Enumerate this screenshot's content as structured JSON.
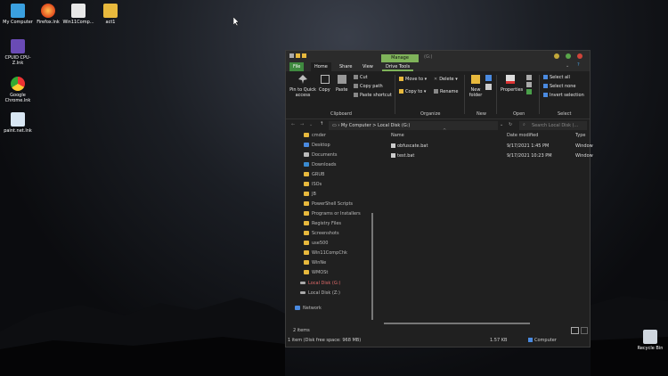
{
  "desktop": {
    "icons": [
      {
        "label": "My Computer"
      },
      {
        "label": "Firefox.lnk"
      },
      {
        "label": "Win11Comp..."
      },
      {
        "label": "act1"
      },
      {
        "label": "CPUID CPU-Z.lnk"
      },
      {
        "label": "Google Chrome.lnk"
      },
      {
        "label": "paint.net.lnk"
      },
      {
        "label": "Recycle Bin"
      }
    ]
  },
  "window": {
    "context_tab": "Manage",
    "context_title": "(G:)",
    "tabs": [
      "File",
      "Home",
      "Share",
      "View",
      "Drive Tools"
    ],
    "ribbon": {
      "pin": "Pin to Quick access",
      "copy": "Copy",
      "paste": "Paste",
      "cut": "Cut",
      "copy_path": "Copy path",
      "paste_shortcut": "Paste shortcut",
      "clipboard": "Clipboard",
      "move_to": "Move to",
      "copy_to": "Copy to",
      "delete": "Delete",
      "rename": "Rename",
      "organize": "Organize",
      "new_folder": "New folder",
      "new": "New",
      "properties": "Properties",
      "open": "Open",
      "select_all": "Select all",
      "select_none": "Select none",
      "invert_selection": "Invert selection",
      "select": "Select"
    },
    "address": {
      "part1": "My Computer",
      "sep": ">",
      "part2": "Local Disk (G:)"
    },
    "search_placeholder": "Search Local Disk (...",
    "nav_items": [
      "cmder",
      "Desktop",
      "Documents",
      "Downloads",
      "GRUB",
      "ISOs",
      "JB",
      "PowerShell Scripts",
      "Programs or Installers",
      "Registry Files",
      "Screenshots",
      "use500",
      "Win11CompChk",
      "WinNe",
      "WMOSt",
      "Local Disk (G:)",
      "Local Disk (Z:)",
      "Network"
    ],
    "columns": {
      "name": "Name",
      "date": "Date modified",
      "type": "Type"
    },
    "files": [
      {
        "name": "obfuscate.bat",
        "date": "9/17/2021 1:45 PM",
        "type": "Window"
      },
      {
        "name": "test.bat",
        "date": "9/17/2021 10:23 PM",
        "type": "Window"
      }
    ],
    "status_items": "2 items",
    "status_bottom_left": "1 item (Disk free space: 968 MB)",
    "status_size": "1.57 KB",
    "status_location": "Computer"
  },
  "colors": {
    "accent_green": "#7fb35a",
    "file_tab": "#3f8a3f",
    "folder": "#e8b93d"
  }
}
